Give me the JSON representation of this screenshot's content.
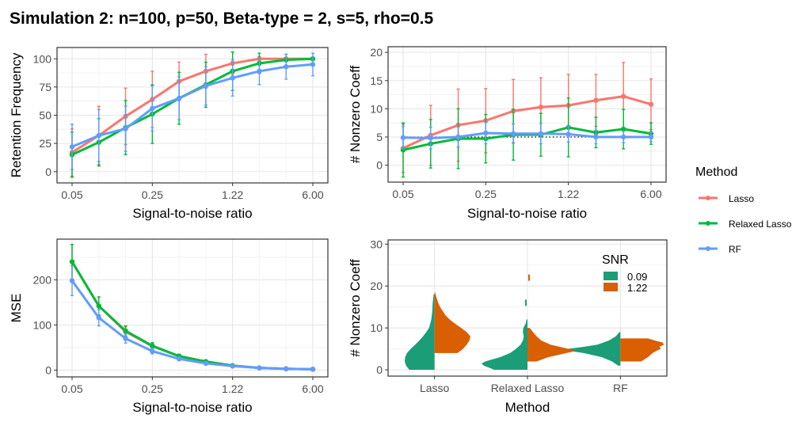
{
  "title": "Simulation 2: n=100, p=50, Beta-type = 2, s=5, rho=0.5",
  "legend_method": {
    "title": "Method",
    "entries": [
      {
        "label": "Lasso",
        "color": "#F8766D"
      },
      {
        "label": "Relaxed Lasso",
        "color": "#00BA38"
      },
      {
        "label": "RF",
        "color": "#619CFF"
      }
    ]
  },
  "chart_data": [
    {
      "id": "retention",
      "type": "line",
      "title": "",
      "xlabel": "Signal-to-noise ratio",
      "ylabel": "Retention Frequency",
      "x": [
        0.05,
        0.09,
        0.14,
        0.25,
        0.42,
        0.71,
        1.22,
        2.07,
        3.52,
        6.0
      ],
      "x_scale": "log-index",
      "xticks": [
        "0.05",
        "0.25",
        "1.22",
        "6.00"
      ],
      "xtick_index": [
        0,
        3,
        6,
        9
      ],
      "yticks": [
        0,
        25,
        50,
        75,
        100
      ],
      "ylim": [
        -10,
        110
      ],
      "grid": true,
      "series": [
        {
          "name": "Lasso",
          "color": "#F8766D",
          "values": [
            17,
            32,
            49,
            64,
            80,
            89,
            96,
            100,
            100,
            100
          ],
          "err": [
            21,
            26,
            25,
            25,
            17,
            15,
            10,
            2,
            1,
            0
          ]
        },
        {
          "name": "Relaxed Lasso",
          "color": "#00BA38",
          "values": [
            15,
            26,
            39,
            51,
            65,
            77,
            89,
            96,
            99,
            100
          ],
          "err": [
            20,
            21,
            24,
            26,
            23,
            20,
            17,
            9,
            5,
            1
          ]
        },
        {
          "name": "RF",
          "color": "#619CFF",
          "values": [
            22,
            32,
            38,
            56,
            65,
            76,
            83,
            89,
            93,
            95
          ],
          "err": [
            20,
            23,
            20,
            20,
            19,
            17,
            16,
            12,
            11,
            10
          ]
        }
      ]
    },
    {
      "id": "nonzero",
      "type": "line",
      "title": "",
      "xlabel": "Signal-to-noise ratio",
      "ylabel": "# Nonzero Coeff",
      "x": [
        0.05,
        0.09,
        0.14,
        0.25,
        0.42,
        0.71,
        1.22,
        2.07,
        3.52,
        6.0
      ],
      "x_scale": "log-index",
      "xticks": [
        "0.05",
        "0.25",
        "1.22",
        "6.00"
      ],
      "xtick_index": [
        0,
        3,
        6,
        9
      ],
      "yticks": [
        0,
        5,
        10,
        15,
        20
      ],
      "ylim": [
        -3,
        21
      ],
      "grid": true,
      "reference_line": {
        "y": 5,
        "style": "dotted",
        "color": "#000000"
      },
      "series": [
        {
          "name": "Lasso",
          "color": "#F8766D",
          "values": [
            3.0,
            5.3,
            7.1,
            7.9,
            9.6,
            10.3,
            10.6,
            11.5,
            12.2,
            10.8
          ],
          "err": [
            4.3,
            5.3,
            6.4,
            5.7,
            5.6,
            5.2,
            5.5,
            4.6,
            6.0,
            4.5
          ]
        },
        {
          "name": "Relaxed Lasso",
          "color": "#00BA38",
          "values": [
            2.7,
            3.8,
            4.7,
            4.7,
            5.4,
            5.4,
            6.7,
            5.8,
            6.4,
            5.6
          ],
          "err": [
            4.8,
            4.3,
            5.3,
            4.3,
            4.5,
            3.8,
            5.2,
            2.7,
            3.5,
            1.9
          ]
        },
        {
          "name": "RF",
          "color": "#619CFF",
          "values": [
            4.9,
            4.8,
            5.0,
            5.7,
            5.6,
            5.6,
            5.5,
            5.0,
            5.0,
            5.0
          ],
          "err": [
            2.0,
            1.9,
            1.8,
            1.9,
            1.7,
            1.8,
            1.4,
            1.2,
            1.0,
            0.8
          ]
        }
      ]
    },
    {
      "id": "mse",
      "type": "line",
      "title": "",
      "xlabel": "Signal-to-noise ratio",
      "ylabel": "MSE",
      "x": [
        0.05,
        0.09,
        0.14,
        0.25,
        0.42,
        0.71,
        1.22,
        2.07,
        3.52,
        6.0
      ],
      "x_scale": "log-index",
      "xticks": [
        "0.05",
        "0.25",
        "1.22",
        "6.00"
      ],
      "xtick_index": [
        0,
        3,
        6,
        9
      ],
      "yticks": [
        0,
        100,
        200
      ],
      "ylim": [
        -15,
        290
      ],
      "grid": true,
      "series": [
        {
          "name": "Lasso",
          "color": "#F8766D",
          "values": [
            240,
            142,
            85,
            53,
            31,
            19,
            10,
            5,
            3,
            2
          ],
          "err": [
            38,
            20,
            11,
            7,
            4,
            3,
            2,
            1,
            1,
            0.5
          ]
        },
        {
          "name": "Relaxed Lasso",
          "color": "#00BA38",
          "values": [
            240,
            142,
            87,
            54,
            31,
            19,
            10,
            5,
            3,
            2
          ],
          "err": [
            38,
            20,
            11,
            7,
            4,
            3,
            2,
            1,
            1,
            0.5
          ]
        },
        {
          "name": "RF",
          "color": "#619CFF",
          "values": [
            198,
            116,
            70,
            42,
            25,
            15,
            9,
            5,
            3,
            2
          ],
          "err": [
            33,
            18,
            10,
            6,
            4,
            2,
            1,
            1,
            0.5,
            0.5
          ]
        }
      ]
    },
    {
      "id": "violin",
      "type": "violin",
      "title": "",
      "xlabel": "Method",
      "ylabel": "# Nonzero Coeff",
      "categories": [
        "Lasso",
        "Relaxed Lasso",
        "RF"
      ],
      "yticks": [
        0,
        10,
        20,
        30
      ],
      "ylim": [
        -1.5,
        31
      ],
      "grid": true,
      "legend": {
        "title": "SNR",
        "position": "top-right",
        "entries": [
          {
            "label": "0.09",
            "color": "#1B9E77"
          },
          {
            "label": "1.22",
            "color": "#D95F02"
          }
        ]
      },
      "groups": [
        {
          "snr": "0.09",
          "color": "#1B9E77",
          "side": "left",
          "densities": [
            {
              "method": "Lasso",
              "y": [
                0,
                1,
                2,
                3,
                4,
                5,
                6,
                7,
                8,
                9,
                10,
                12,
                14,
                16,
                18
              ],
              "w": [
                0.55,
                0.62,
                0.65,
                0.64,
                0.6,
                0.52,
                0.42,
                0.33,
                0.25,
                0.18,
                0.12,
                0.07,
                0.05,
                0.04,
                0.02
              ]
            },
            {
              "method": "Relaxed Lasso",
              "y": [
                0,
                1,
                1.5,
                2,
                3,
                4,
                5,
                6,
                7,
                8,
                9,
                10,
                11,
                12
              ],
              "w": [
                0.72,
                0.95,
                1.0,
                0.92,
                0.6,
                0.38,
                0.25,
                0.15,
                0.1,
                0.08,
                0.1,
                0.09,
                0.04,
                0.02
              ]
            },
            {
              "method": "RF",
              "y": [
                1,
                2,
                3,
                4,
                4.5,
                5,
                5.5,
                6,
                7,
                8,
                9
              ],
              "w": [
                0.05,
                0.18,
                0.4,
                0.8,
                1.1,
                1.15,
                0.8,
                0.5,
                0.25,
                0.1,
                0.02
              ]
            }
          ]
        },
        {
          "snr": "1.22",
          "color": "#D95F02",
          "side": "right",
          "densities": [
            {
              "method": "Lasso",
              "y": [
                4,
                5,
                6,
                7,
                8,
                9,
                10,
                11,
                12,
                13,
                14,
                15,
                16,
                17,
                18.5
              ],
              "w": [
                0.5,
                0.62,
                0.7,
                0.76,
                0.78,
                0.7,
                0.58,
                0.45,
                0.33,
                0.24,
                0.18,
                0.12,
                0.08,
                0.05,
                0.01
              ]
            },
            {
              "method": "Relaxed Lasso",
              "y": [
                2,
                3,
                4,
                4.5,
                5,
                6,
                7,
                8,
                9,
                10
              ],
              "w": [
                0.2,
                0.45,
                0.85,
                1.05,
                0.9,
                0.5,
                0.3,
                0.2,
                0.12,
                0.05
              ]
            },
            {
              "method": "RF",
              "y": [
                2,
                3,
                4,
                4.5,
                5,
                5.5,
                6,
                6.5,
                7,
                7.5
              ],
              "w": [
                0.45,
                0.6,
                0.7,
                0.78,
                0.88,
                0.85,
                0.95,
                0.92,
                0.75,
                0.6
              ]
            }
          ]
        }
      ],
      "outliers": [
        {
          "method": "Relaxed Lasso",
          "snr": "1.22",
          "y": 22
        },
        {
          "method": "Relaxed Lasso",
          "snr": "0.09",
          "y": 16
        }
      ]
    }
  ]
}
